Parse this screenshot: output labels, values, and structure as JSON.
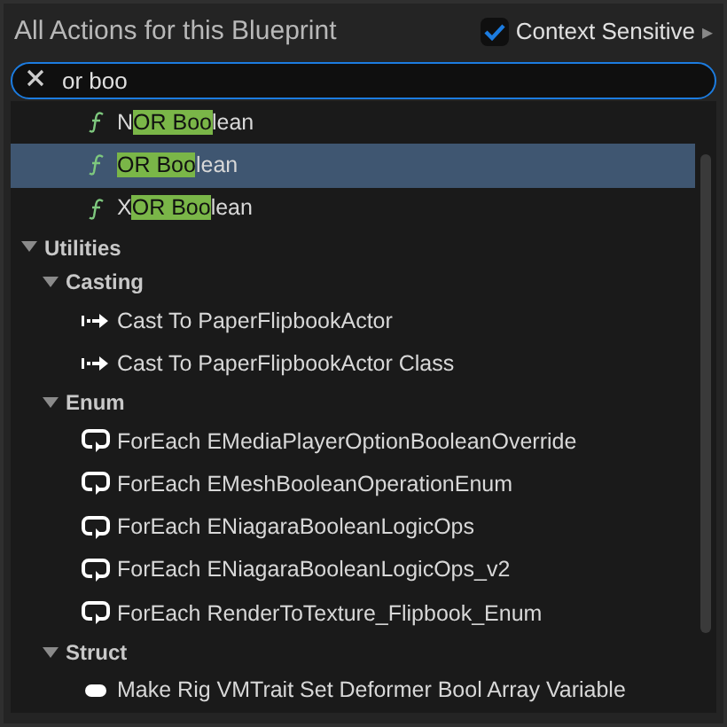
{
  "header": {
    "title": "All Actions for this Blueprint",
    "context_sensitive": {
      "label": "Context Sensitive",
      "checked": true,
      "arrow": "▸"
    }
  },
  "search": {
    "value": "or boo"
  },
  "items": [
    {
      "kind": "function",
      "prefix": "N",
      "match": "OR Boo",
      "suffix": "lean",
      "selected": false
    },
    {
      "kind": "function",
      "match": "OR Boo",
      "suffix": "lean",
      "selected": true
    },
    {
      "kind": "function",
      "prefix": "X",
      "match": "OR Boo",
      "suffix": "lean",
      "selected": false
    }
  ],
  "tree": [
    {
      "label": "Utilities",
      "expanded": true,
      "children": [
        {
          "label": "Casting",
          "expanded": true,
          "children": [
            {
              "kind": "cast",
              "label": "Cast To PaperFlipbookActor"
            },
            {
              "kind": "cast",
              "label": "Cast To PaperFlipbookActor Class"
            }
          ]
        },
        {
          "label": "Enum",
          "expanded": true,
          "children": [
            {
              "kind": "foreach",
              "label": "ForEach EMediaPlayerOptionBooleanOverride"
            },
            {
              "kind": "foreach",
              "label": "ForEach EMeshBooleanOperationEnum"
            },
            {
              "kind": "foreach",
              "label": "ForEach ENiagaraBooleanLogicOps"
            },
            {
              "kind": "foreach",
              "label": "ForEach ENiagaraBooleanLogicOps_v2"
            },
            {
              "kind": "foreach",
              "label": "ForEach RenderToTexture_Flipbook_Enum"
            }
          ]
        },
        {
          "label": "Struct",
          "expanded": true,
          "children": [
            {
              "kind": "struct",
              "label": "Make Rig VMTrait Set Deformer Bool Array Variable"
            }
          ]
        }
      ]
    }
  ]
}
